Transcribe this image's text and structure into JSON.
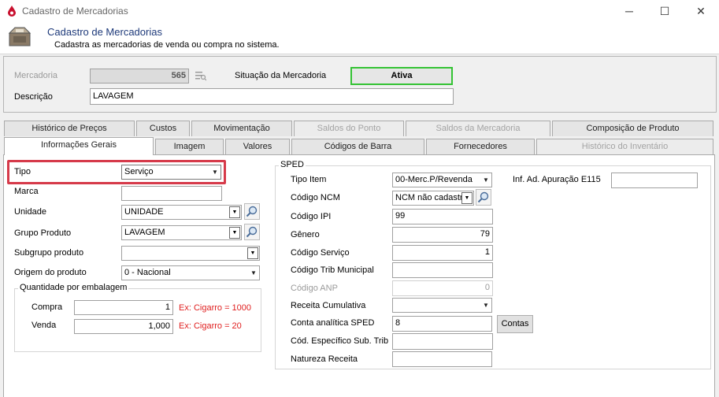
{
  "window": {
    "title": "Cadastro de Mercadorias",
    "minimize_glyph": "─",
    "maximize_glyph": "☐",
    "close_glyph": "✕"
  },
  "header": {
    "title": "Cadastro de Mercadorias",
    "subtitle": "Cadastra as mercadorias de venda ou compra no sistema."
  },
  "top": {
    "mercadoria_label": "Mercadoria",
    "mercadoria_value": "565",
    "situacao_label": "Situação da Mercadoria",
    "situacao_value": "Ativa",
    "descricao_label": "Descrição",
    "descricao_value": "LAVAGEM"
  },
  "tabs_row1": [
    {
      "label": "Histórico de Preços"
    },
    {
      "label": "Custos"
    },
    {
      "label": "Movimentação"
    },
    {
      "label": "Saldos do Ponto"
    },
    {
      "label": "Saldos da Mercadoria"
    },
    {
      "label": "Composição de Produto"
    }
  ],
  "tabs_row2": [
    {
      "label": "Informações Gerais"
    },
    {
      "label": "Imagem"
    },
    {
      "label": "Valores"
    },
    {
      "label": "Códigos de Barra"
    },
    {
      "label": "Fornecedores"
    },
    {
      "label": "Histórico do Inventário"
    }
  ],
  "left": {
    "tipo_label": "Tipo",
    "tipo_value": "Serviço",
    "marca_label": "Marca",
    "marca_value": "",
    "unidade_label": "Unidade",
    "unidade_value": "UNIDADE",
    "grupo_label": "Grupo Produto",
    "grupo_value": "LAVAGEM",
    "subgrupo_label": "Subgrupo produto",
    "subgrupo_value": "",
    "origem_label": "Origem do produto",
    "origem_value": "0 - Nacional",
    "qtd_group_title": "Quantidade por embalagem",
    "compra_label": "Compra",
    "compra_value": "1",
    "compra_hint": "Ex: Cigarro = 1000",
    "venda_label": "Venda",
    "venda_value": "1,000",
    "venda_hint": "Ex: Cigarro = 20"
  },
  "sped": {
    "group_title": "SPED",
    "tipo_item_label": "Tipo Item",
    "tipo_item_value": "00-Merc.P/Revenda",
    "inf_label": "Inf. Ad. Apuração E115",
    "inf_value": "",
    "ncm_label": "Código NCM",
    "ncm_value": "NCM não cadastr",
    "ipi_label": "Código IPI",
    "ipi_value": "99",
    "genero_label": "Gênero",
    "genero_value": "79",
    "servico_label": "Código Serviço",
    "servico_value": "1",
    "trib_mun_label": "Código Trib Municipal",
    "trib_mun_value": "",
    "anp_label": "Código ANP",
    "anp_value": "0",
    "receita_cum_label": "Receita Cumulativa",
    "receita_cum_value": "",
    "conta_label": "Conta analítica SPED",
    "conta_value": "8",
    "contas_button": "Contas",
    "cod_esp_label": "Cód. Específico Sub. Trib",
    "cod_esp_value": "",
    "natureza_label": "Natureza Receita",
    "natureza_value": ""
  },
  "colors": {
    "header_title": "#1e3a7a",
    "active_status_border": "#34c334",
    "highlight_border": "#d63a4a",
    "hint_red": "#e02020"
  },
  "icons": [
    "app-drop-icon",
    "product-box-icon",
    "list-lookup-icon",
    "magnifier-icon",
    "dropdown-arrow-icon"
  ]
}
